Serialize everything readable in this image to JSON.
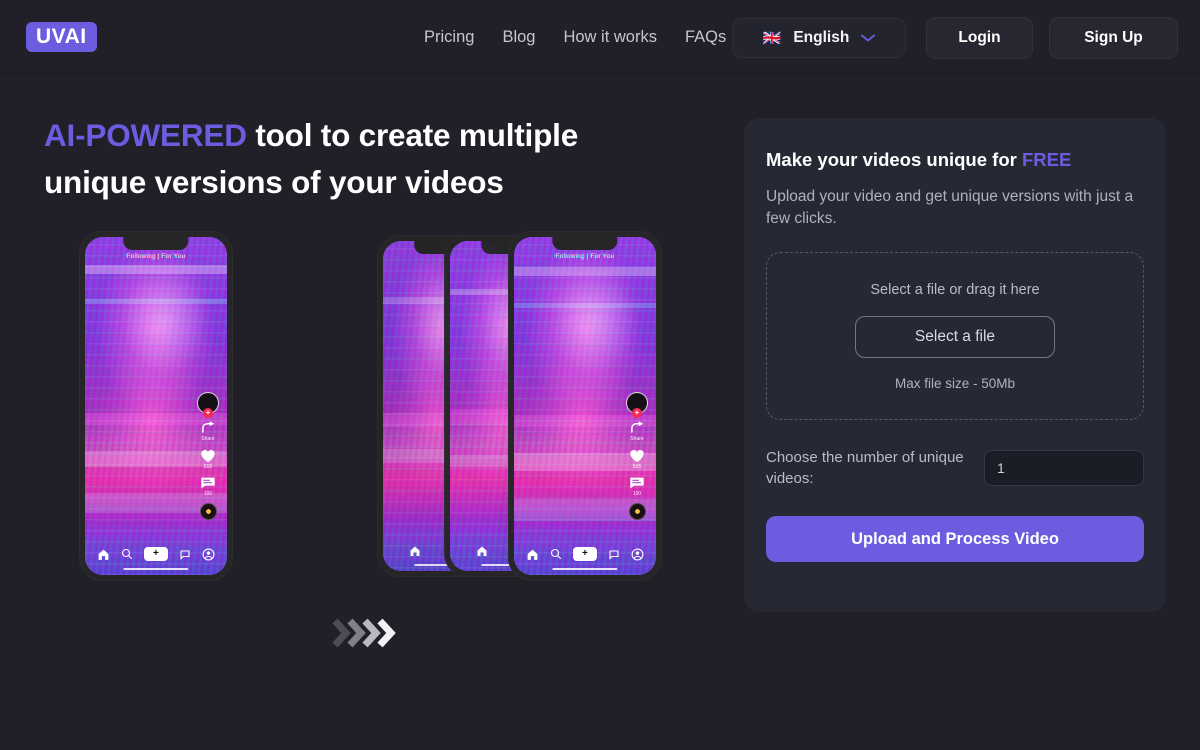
{
  "brand": {
    "logo_text": "UVAI",
    "accent": "#6c5ce0"
  },
  "header": {
    "nav": [
      {
        "label": "Pricing"
      },
      {
        "label": "Blog"
      },
      {
        "label": "How it works"
      },
      {
        "label": "FAQs"
      }
    ],
    "language": {
      "flag": "🇬🇧",
      "label": "English",
      "chevron": "chevron-down-icon"
    },
    "login_label": "Login",
    "signup_label": "Sign Up"
  },
  "hero": {
    "headline_accent": "AI-POWERED",
    "headline_rest": " tool to create multiple unique versions of your videos"
  },
  "mock": {
    "top_text": "Following | For You",
    "share_label": "Share",
    "like_count": "555",
    "comment_count": "100",
    "plus_glyph": "+",
    "avatar_plus": "+"
  },
  "card": {
    "title_main": "Make your videos unique for ",
    "title_free": "FREE",
    "subtitle": "Upload your video and get unique versions with just a few clicks.",
    "dropzone": {
      "prompt": "Select a file or drag it here",
      "button_label": "Select a file",
      "max_size": "Max file size - 50Mb"
    },
    "count": {
      "label": "Choose the number of unique videos:",
      "value": "1",
      "placeholder": "1"
    },
    "cta_label": "Upload and Process Video"
  },
  "colors": {
    "background": "#212028",
    "card_background": "#262934",
    "accent_purple": "#6c5ce0",
    "text_primary": "#ffffff",
    "text_muted": "#aeb2c0"
  }
}
